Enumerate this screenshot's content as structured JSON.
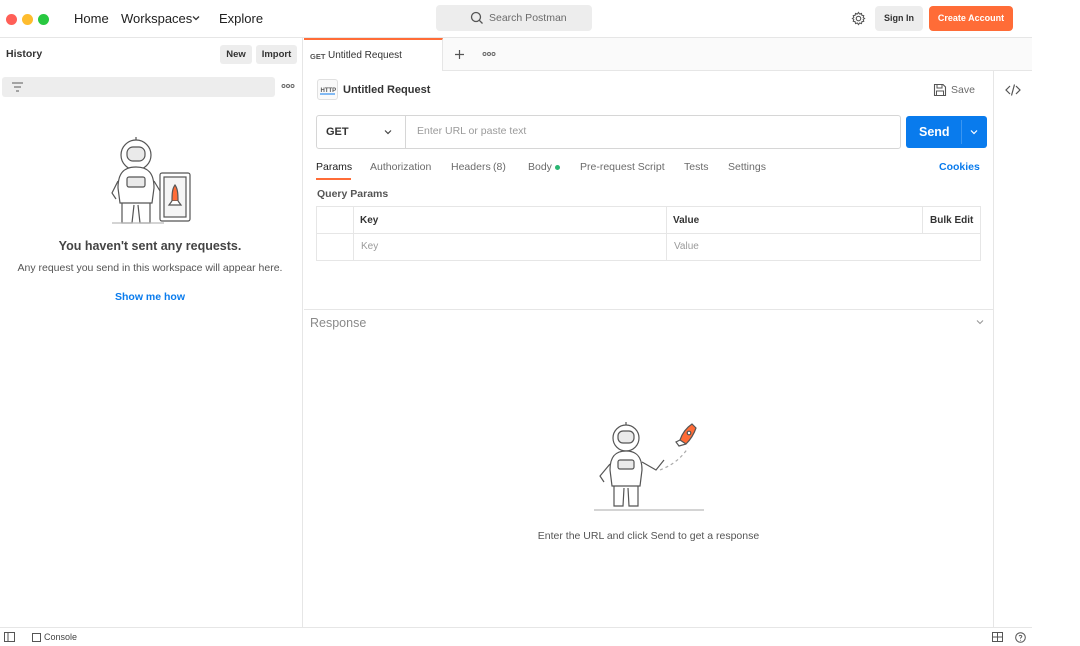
{
  "topbar": {
    "nav": {
      "home": "Home",
      "workspaces": "Workspaces",
      "explore": "Explore"
    },
    "search_placeholder": "Search Postman",
    "sign_in": "Sign In",
    "create_account": "Create Account"
  },
  "sidebar": {
    "title": "History",
    "new_label": "New",
    "import_label": "Import",
    "empty_title": "You haven't sent any requests.",
    "empty_text": "Any request you send in this workspace will appear here.",
    "show_me_how": "Show me how"
  },
  "tab": {
    "method": "GET",
    "name": "Untitled Request"
  },
  "request": {
    "name": "Untitled Request",
    "save_label": "Save",
    "method": "GET",
    "url_placeholder": "Enter URL or paste text",
    "send_label": "Send",
    "tabs": {
      "params": "Params",
      "authorization": "Authorization",
      "headers": "Headers",
      "headers_count": "(8)",
      "body": "Body",
      "pre_request": "Pre-request Script",
      "tests": "Tests",
      "settings": "Settings",
      "cookies": "Cookies"
    },
    "query_params_title": "Query Params",
    "table": {
      "key_header": "Key",
      "value_header": "Value",
      "bulk_edit": "Bulk Edit",
      "key_placeholder": "Key",
      "value_placeholder": "Value"
    }
  },
  "response": {
    "title": "Response",
    "empty_text": "Enter the URL and click Send to get a response"
  },
  "statusbar": {
    "console": "Console"
  },
  "colors": {
    "accent": "#ff6c37",
    "send": "#097bed",
    "body_dot": "#2bb673"
  }
}
